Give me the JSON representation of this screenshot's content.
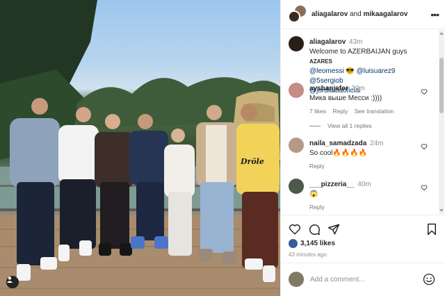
{
  "header": {
    "user1": "aliagalarov",
    "joiner": "and",
    "user2": "mikaagalarov",
    "more_icon": "more-horizontal-icon"
  },
  "caption": {
    "user": "aliagalarov",
    "time": "43m",
    "text": "Welcome to AZERBAIJAN guys",
    "badge": "AZARES",
    "mentions": [
      "@leomessi",
      "@luisuarez9",
      "@5sergiob",
      "@jordialbaoficial"
    ],
    "emoji": "😎"
  },
  "comments": [
    {
      "user": "ayshanjafer",
      "time": "39m",
      "text": "Мика выше Месси :))))",
      "likes": "7 likes",
      "reply": "Reply",
      "translate": "See translation",
      "avatar_color": "#c58c88"
    },
    {
      "user": "naila_samadzada",
      "time": "24m",
      "text": "So cool🔥🔥🔥🔥",
      "reply": "Reply",
      "avatar_color": "#b49a86"
    },
    {
      "user": "___pizzeria__",
      "time": "40m",
      "text": "😱",
      "reply": "Reply",
      "avatar_color": "#4d5a4a"
    }
  ],
  "view_replies": "View all 1 replies",
  "actions": {
    "likes": "3,145 likes",
    "time_ago": "43 minutes ago",
    "icons": [
      "heart-icon",
      "comment-icon",
      "share-icon",
      "bookmark-icon"
    ]
  },
  "add_comment": {
    "placeholder": "Add a comment...",
    "emoji_icon": "smile-icon"
  },
  "photo": {
    "sign_text": "Dröle"
  }
}
